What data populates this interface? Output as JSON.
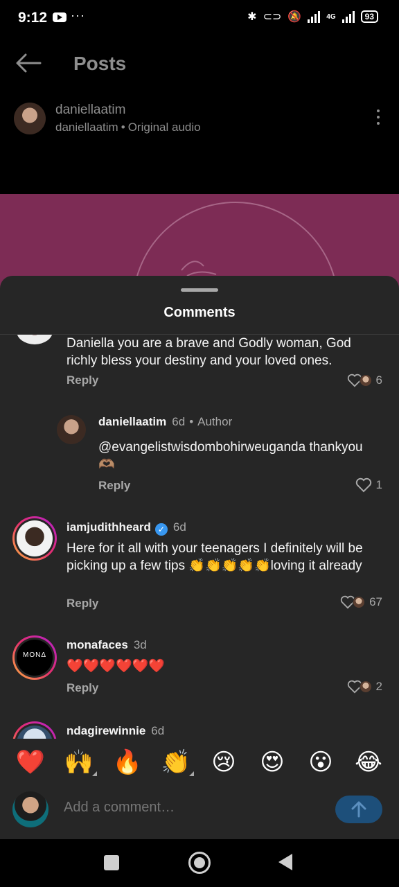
{
  "status_bar": {
    "time": "9:12",
    "dots": "···",
    "network": "4G",
    "battery": "93"
  },
  "header": {
    "title": "Posts"
  },
  "post": {
    "username": "daniellaatim",
    "subtitle_user": "daniellaatim",
    "separator": "•",
    "audio": "Original audio"
  },
  "sheet": {
    "title": "Comments"
  },
  "comments": [
    {
      "username": "",
      "text": "Daniella you are a brave and Godly woman, God richly bless your destiny and your loved ones.",
      "reply": "Reply",
      "likes": "6"
    },
    {
      "username": "daniellaatim",
      "age": "6d",
      "sep": "•",
      "badge": "Author",
      "text": "@evangelistwisdombohirweuganda thankyou 🫶🏽",
      "reply": "Reply",
      "likes": "1"
    },
    {
      "username": "iamjudithheard",
      "age": "6d",
      "text": "Here for it all with your teenagers I definitely will be picking up a few tips 👏👏👏👏👏loving it already",
      "reply": "Reply",
      "likes": "67"
    },
    {
      "username": "monafaces",
      "age": "3d",
      "avatar_text": "MONΔ",
      "text": "❤️❤️❤️❤️❤️❤️",
      "reply": "Reply",
      "likes": "2"
    },
    {
      "username": "ndagirewinnie",
      "age": "6d"
    }
  ],
  "reactions": [
    "❤️",
    "🙌",
    "🔥",
    "👏",
    "😢",
    "😍",
    "😮",
    "😂"
  ],
  "input": {
    "placeholder": "Add a comment…"
  },
  "colors": {
    "sheet": "#262626",
    "media": "#7d2c55",
    "accent": "#3897f0"
  }
}
